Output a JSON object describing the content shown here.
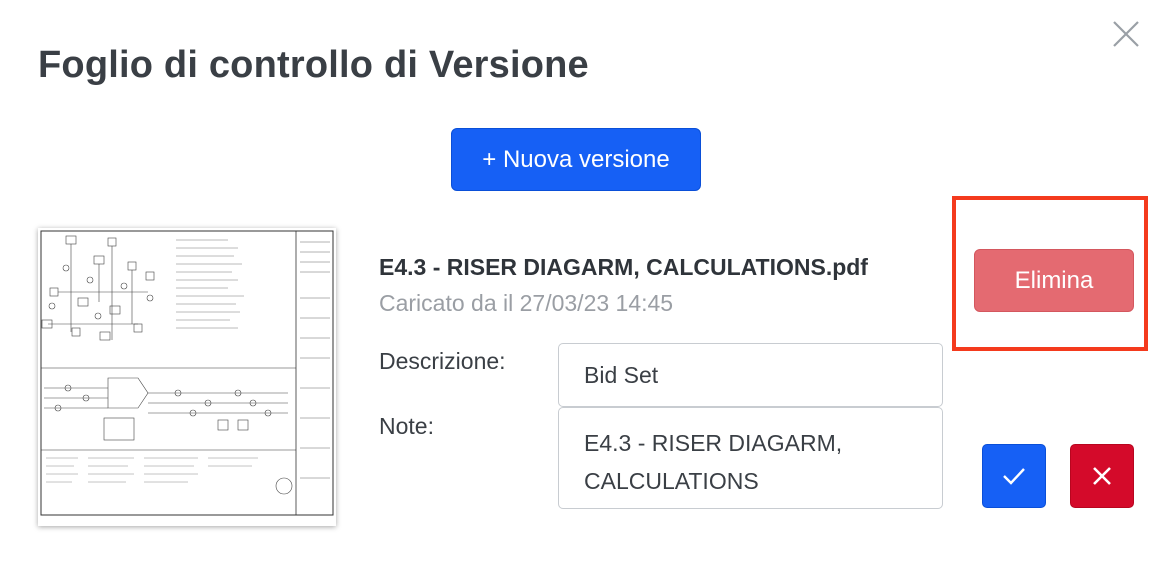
{
  "dialog": {
    "title": "Foglio di controllo di Versione",
    "close_icon": "close-icon"
  },
  "toolbar": {
    "new_version_label": "+ Nuova versione"
  },
  "version": {
    "file_name": "E4.3 - RISER DIAGARM, CALCULATIONS.pdf",
    "uploaded_text": "Caricato da il 27/03/23 14:45",
    "thumbnail": "document-thumbnail"
  },
  "form": {
    "description_label": "Descrizione:",
    "description_value": "Bid Set",
    "note_label": "Note:",
    "note_value": "E4.3 - RISER DIAGARM,\nCALCULATIONS"
  },
  "actions": {
    "delete_label": "Elimina",
    "confirm_icon": "check-icon",
    "cancel_icon": "x-icon"
  },
  "colors": {
    "primary": "#1660f5",
    "danger": "#d40a2a",
    "delete_button": "#e46a71",
    "highlight": "#f43a1d"
  }
}
